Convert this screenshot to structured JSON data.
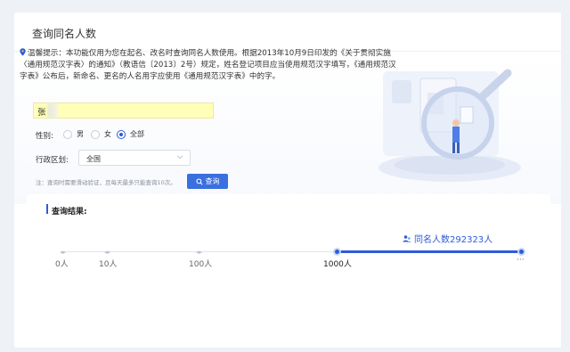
{
  "page": {
    "title": "查询同名人数"
  },
  "tip": {
    "icon": "pin-icon",
    "text": "温馨提示：本功能仅用为您在起名、改名时查询同名人数使用。根据2013年10月9日印发的《关于贯彻实施〈通用规范汉字表〉的通知》（教语信〔2013〕2号）规定，姓名登记项目应当使用规范汉字填写，《通用规范汉字表》公布后，新命名、更名的人名用字应使用《通用规范汉字表》中的字。"
  },
  "form": {
    "name_value": "张",
    "gender_label": "性别:",
    "gender_options": [
      {
        "label": "男",
        "selected": false
      },
      {
        "label": "女",
        "selected": false
      },
      {
        "label": "全部",
        "selected": true
      }
    ],
    "region_label": "行政区划:",
    "region_value": "全国",
    "note": "注：查询时需要滑动验证，且每天最多只能查询10次。",
    "search_label": "查询"
  },
  "result": {
    "title": "查询结果:",
    "count_label": "同名人数292323人",
    "ticks": [
      "0人",
      "10人",
      "100人",
      "1000人"
    ],
    "ellipsis": "···",
    "active_tick": "1000人"
  },
  "colors": {
    "accent": "#2e5bd9",
    "highlight": "#ffffb8"
  }
}
